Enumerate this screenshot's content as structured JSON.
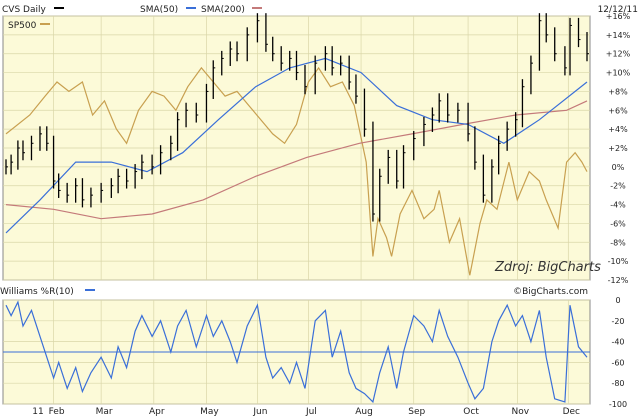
{
  "chart_data": [
    {
      "type": "ohlc",
      "title": "CVS Daily",
      "date": "12/12/11",
      "legend": [
        {
          "label": "CVS Daily",
          "color": "#000000"
        },
        {
          "label": "SMA(50)",
          "color": "#3a6fd8"
        },
        {
          "label": "SMA(200)",
          "color": "#c47a7a"
        },
        {
          "label": "SP500",
          "color": "#c8a050"
        }
      ],
      "watermark": "Zdroj: BigCharts",
      "y_axis": {
        "unit": "%",
        "min": -12,
        "max": 16,
        "ticks": [
          "+16%",
          "+14%",
          "+12%",
          "+10%",
          "+8%",
          "+6%",
          "+4%",
          "+2%",
          "0%",
          "-2%",
          "-4%",
          "-6%",
          "-8%",
          "-10%",
          "-12%"
        ],
        "position": "right"
      },
      "grid": true,
      "background": "#fcfad8",
      "colors": {
        "price": "#000000",
        "sma50": "#3a6fd8",
        "sma200": "#c47a7a",
        "sp500": "#c8a050"
      },
      "x_start": "2011-01-04",
      "x_end": "2011-12-12",
      "series": {
        "price_close": [
          {
            "x": "2011-01-04",
            "y": 0.0
          },
          {
            "x": "2011-01-07",
            "y": 0.5
          },
          {
            "x": "2011-01-11",
            "y": 2.0
          },
          {
            "x": "2011-01-14",
            "y": 1.5
          },
          {
            "x": "2011-01-19",
            "y": 2.5
          },
          {
            "x": "2011-01-24",
            "y": 3.5
          },
          {
            "x": "2011-01-28",
            "y": 2.5
          },
          {
            "x": "2011-02-01",
            "y": -1.5
          },
          {
            "x": "2011-02-04",
            "y": -2.5
          },
          {
            "x": "2011-02-09",
            "y": -3.0
          },
          {
            "x": "2011-02-14",
            "y": -2.0
          },
          {
            "x": "2011-02-18",
            "y": -3.5
          },
          {
            "x": "2011-02-23",
            "y": -3.0
          },
          {
            "x": "2011-03-01",
            "y": -2.5
          },
          {
            "x": "2011-03-07",
            "y": -2.0
          },
          {
            "x": "2011-03-11",
            "y": -1.0
          },
          {
            "x": "2011-03-16",
            "y": -1.5
          },
          {
            "x": "2011-03-21",
            "y": -0.5
          },
          {
            "x": "2011-03-25",
            "y": 0.5
          },
          {
            "x": "2011-03-31",
            "y": 0.0
          },
          {
            "x": "2011-04-05",
            "y": 1.5
          },
          {
            "x": "2011-04-11",
            "y": 2.5
          },
          {
            "x": "2011-04-15",
            "y": 5.0
          },
          {
            "x": "2011-04-20",
            "y": 6.0
          },
          {
            "x": "2011-04-26",
            "y": 5.5
          },
          {
            "x": "2011-05-02",
            "y": 8.0
          },
          {
            "x": "2011-05-06",
            "y": 10.5
          },
          {
            "x": "2011-05-11",
            "y": 11.5
          },
          {
            "x": "2011-05-16",
            "y": 12.5
          },
          {
            "x": "2011-05-20",
            "y": 12.0
          },
          {
            "x": "2011-05-26",
            "y": 14.0
          },
          {
            "x": "2011-06-01",
            "y": 15.5
          },
          {
            "x": "2011-06-06",
            "y": 13.0
          },
          {
            "x": "2011-06-10",
            "y": 12.0
          },
          {
            "x": "2011-06-15",
            "y": 11.0
          },
          {
            "x": "2011-06-20",
            "y": 11.5
          },
          {
            "x": "2011-06-24",
            "y": 10.0
          },
          {
            "x": "2011-06-29",
            "y": 8.5
          },
          {
            "x": "2011-07-05",
            "y": 11.0
          },
          {
            "x": "2011-07-11",
            "y": 12.0
          },
          {
            "x": "2011-07-15",
            "y": 10.5
          },
          {
            "x": "2011-07-20",
            "y": 11.0
          },
          {
            "x": "2011-07-25",
            "y": 9.0
          },
          {
            "x": "2011-07-29",
            "y": 7.5
          },
          {
            "x": "2011-08-03",
            "y": 4.0
          },
          {
            "x": "2011-08-08",
            "y": -5.0
          },
          {
            "x": "2011-08-12",
            "y": -1.0
          },
          {
            "x": "2011-08-17",
            "y": 1.0
          },
          {
            "x": "2011-08-22",
            "y": -1.5
          },
          {
            "x": "2011-08-26",
            "y": 1.5
          },
          {
            "x": "2011-09-01",
            "y": 3.0
          },
          {
            "x": "2011-09-07",
            "y": 4.5
          },
          {
            "x": "2011-09-12",
            "y": 5.5
          },
          {
            "x": "2011-09-16",
            "y": 7.0
          },
          {
            "x": "2011-09-21",
            "y": 5.5
          },
          {
            "x": "2011-09-27",
            "y": 6.0
          },
          {
            "x": "2011-10-03",
            "y": 3.5
          },
          {
            "x": "2011-10-07",
            "y": 0.5
          },
          {
            "x": "2011-10-12",
            "y": -3.0
          },
          {
            "x": "2011-10-17",
            "y": 0.0
          },
          {
            "x": "2011-10-21",
            "y": 2.5
          },
          {
            "x": "2011-10-26",
            "y": 4.0
          },
          {
            "x": "2011-10-31",
            "y": 5.0
          },
          {
            "x": "2011-11-04",
            "y": 8.5
          },
          {
            "x": "2011-11-09",
            "y": 11.0
          },
          {
            "x": "2011-11-14",
            "y": 15.5
          },
          {
            "x": "2011-11-18",
            "y": 14.0
          },
          {
            "x": "2011-11-23",
            "y": 12.0
          },
          {
            "x": "2011-11-29",
            "y": 10.5
          },
          {
            "x": "2011-12-02",
            "y": 15.0
          },
          {
            "x": "2011-12-07",
            "y": 13.5
          },
          {
            "x": "2011-12-12",
            "y": 12.0
          }
        ],
        "sma50": [
          {
            "x": "2011-01-04",
            "y": -7.0
          },
          {
            "x": "2011-01-24",
            "y": -3.5
          },
          {
            "x": "2011-02-14",
            "y": 0.5
          },
          {
            "x": "2011-03-07",
            "y": 0.5
          },
          {
            "x": "2011-03-28",
            "y": -0.5
          },
          {
            "x": "2011-04-18",
            "y": 1.5
          },
          {
            "x": "2011-05-09",
            "y": 5.0
          },
          {
            "x": "2011-05-31",
            "y": 8.5
          },
          {
            "x": "2011-06-20",
            "y": 10.5
          },
          {
            "x": "2011-07-11",
            "y": 11.5
          },
          {
            "x": "2011-08-01",
            "y": 10.0
          },
          {
            "x": "2011-08-22",
            "y": 6.5
          },
          {
            "x": "2011-09-12",
            "y": 5.0
          },
          {
            "x": "2011-10-03",
            "y": 4.5
          },
          {
            "x": "2011-10-24",
            "y": 2.5
          },
          {
            "x": "2011-11-14",
            "y": 5.0
          },
          {
            "x": "2011-12-12",
            "y": 9.0
          }
        ],
        "sma200": [
          {
            "x": "2011-01-04",
            "y": -4.0
          },
          {
            "x": "2011-02-01",
            "y": -4.5
          },
          {
            "x": "2011-03-01",
            "y": -5.5
          },
          {
            "x": "2011-03-31",
            "y": -5.0
          },
          {
            "x": "2011-04-30",
            "y": -3.5
          },
          {
            "x": "2011-05-31",
            "y": -1.0
          },
          {
            "x": "2011-06-30",
            "y": 1.0
          },
          {
            "x": "2011-07-31",
            "y": 2.5
          },
          {
            "x": "2011-08-31",
            "y": 3.5
          },
          {
            "x": "2011-09-30",
            "y": 4.5
          },
          {
            "x": "2011-10-31",
            "y": 5.5
          },
          {
            "x": "2011-11-30",
            "y": 6.0
          },
          {
            "x": "2011-12-12",
            "y": 7.0
          }
        ],
        "sp500": [
          {
            "x": "2011-01-04",
            "y": 3.5
          },
          {
            "x": "2011-01-18",
            "y": 5.5
          },
          {
            "x": "2011-01-27",
            "y": 7.5
          },
          {
            "x": "2011-02-03",
            "y": 9.0
          },
          {
            "x": "2011-02-10",
            "y": 8.0
          },
          {
            "x": "2011-02-18",
            "y": 9.0
          },
          {
            "x": "2011-02-24",
            "y": 5.5
          },
          {
            "x": "2011-03-03",
            "y": 7.0
          },
          {
            "x": "2011-03-10",
            "y": 4.0
          },
          {
            "x": "2011-03-16",
            "y": 2.5
          },
          {
            "x": "2011-03-23",
            "y": 6.0
          },
          {
            "x": "2011-03-31",
            "y": 8.0
          },
          {
            "x": "2011-04-07",
            "y": 7.5
          },
          {
            "x": "2011-04-14",
            "y": 6.0
          },
          {
            "x": "2011-04-21",
            "y": 8.5
          },
          {
            "x": "2011-04-29",
            "y": 10.5
          },
          {
            "x": "2011-05-06",
            "y": 9.0
          },
          {
            "x": "2011-05-13",
            "y": 7.5
          },
          {
            "x": "2011-05-20",
            "y": 8.0
          },
          {
            "x": "2011-05-27",
            "y": 6.5
          },
          {
            "x": "2011-06-03",
            "y": 5.0
          },
          {
            "x": "2011-06-10",
            "y": 3.5
          },
          {
            "x": "2011-06-17",
            "y": 2.5
          },
          {
            "x": "2011-06-24",
            "y": 4.5
          },
          {
            "x": "2011-07-01",
            "y": 9.0
          },
          {
            "x": "2011-07-07",
            "y": 10.5
          },
          {
            "x": "2011-07-14",
            "y": 8.5
          },
          {
            "x": "2011-07-21",
            "y": 9.0
          },
          {
            "x": "2011-07-28",
            "y": 6.5
          },
          {
            "x": "2011-08-04",
            "y": 0.5
          },
          {
            "x": "2011-08-08",
            "y": -9.5
          },
          {
            "x": "2011-08-11",
            "y": -5.5
          },
          {
            "x": "2011-08-16",
            "y": -7.5
          },
          {
            "x": "2011-08-19",
            "y": -9.5
          },
          {
            "x": "2011-08-24",
            "y": -5.0
          },
          {
            "x": "2011-08-31",
            "y": -2.5
          },
          {
            "x": "2011-09-07",
            "y": -5.5
          },
          {
            "x": "2011-09-13",
            "y": -4.5
          },
          {
            "x": "2011-09-16",
            "y": -2.5
          },
          {
            "x": "2011-09-22",
            "y": -8.0
          },
          {
            "x": "2011-09-28",
            "y": -5.5
          },
          {
            "x": "2011-10-04",
            "y": -11.5
          },
          {
            "x": "2011-10-10",
            "y": -6.0
          },
          {
            "x": "2011-10-14",
            "y": -3.5
          },
          {
            "x": "2011-10-20",
            "y": -4.5
          },
          {
            "x": "2011-10-27",
            "y": 0.5
          },
          {
            "x": "2011-11-01",
            "y": -3.5
          },
          {
            "x": "2011-11-08",
            "y": -0.5
          },
          {
            "x": "2011-11-14",
            "y": -1.5
          },
          {
            "x": "2011-11-18",
            "y": -3.5
          },
          {
            "x": "2011-11-25",
            "y": -6.5
          },
          {
            "x": "2011-11-30",
            "y": 0.5
          },
          {
            "x": "2011-12-05",
            "y": 1.5
          },
          {
            "x": "2011-12-09",
            "y": 0.5
          },
          {
            "x": "2011-12-12",
            "y": -0.5
          }
        ]
      }
    },
    {
      "type": "line",
      "title": "Williams %R(10)",
      "series": [
        {
          "name": "Williams %R(10)",
          "color": "#3a6fd8"
        }
      ],
      "y_axis": {
        "min": -100,
        "max": 0,
        "ticks": [
          "0",
          "-20",
          "-40",
          "-60",
          "-80",
          "-100"
        ],
        "position": "right"
      },
      "reference_line": -50,
      "grid": true,
      "background": "#fcfad8",
      "x_ticks": [
        "11",
        "Feb",
        "Mar",
        "Apr",
        "May",
        "Jun",
        "Jul",
        "Aug",
        "Sep",
        "Oct",
        "Nov",
        "Dec"
      ],
      "values": [
        {
          "x": "2011-01-04",
          "y": -5
        },
        {
          "x": "2011-01-07",
          "y": -15
        },
        {
          "x": "2011-01-11",
          "y": -2
        },
        {
          "x": "2011-01-14",
          "y": -25
        },
        {
          "x": "2011-01-19",
          "y": -10
        },
        {
          "x": "2011-01-24",
          "y": -35
        },
        {
          "x": "2011-01-28",
          "y": -55
        },
        {
          "x": "2011-02-01",
          "y": -75
        },
        {
          "x": "2011-02-04",
          "y": -60
        },
        {
          "x": "2011-02-09",
          "y": -85
        },
        {
          "x": "2011-02-14",
          "y": -65
        },
        {
          "x": "2011-02-18",
          "y": -88
        },
        {
          "x": "2011-02-23",
          "y": -70
        },
        {
          "x": "2011-03-01",
          "y": -55
        },
        {
          "x": "2011-03-07",
          "y": -75
        },
        {
          "x": "2011-03-11",
          "y": -45
        },
        {
          "x": "2011-03-16",
          "y": -65
        },
        {
          "x": "2011-03-21",
          "y": -30
        },
        {
          "x": "2011-03-25",
          "y": -15
        },
        {
          "x": "2011-03-31",
          "y": -35
        },
        {
          "x": "2011-04-05",
          "y": -20
        },
        {
          "x": "2011-04-11",
          "y": -50
        },
        {
          "x": "2011-04-15",
          "y": -25
        },
        {
          "x": "2011-04-20",
          "y": -10
        },
        {
          "x": "2011-04-26",
          "y": -45
        },
        {
          "x": "2011-05-02",
          "y": -15
        },
        {
          "x": "2011-05-06",
          "y": -35
        },
        {
          "x": "2011-05-11",
          "y": -20
        },
        {
          "x": "2011-05-16",
          "y": -40
        },
        {
          "x": "2011-05-20",
          "y": -60
        },
        {
          "x": "2011-05-26",
          "y": -25
        },
        {
          "x": "2011-06-01",
          "y": -5
        },
        {
          "x": "2011-06-06",
          "y": -55
        },
        {
          "x": "2011-06-10",
          "y": -75
        },
        {
          "x": "2011-06-15",
          "y": -65
        },
        {
          "x": "2011-06-20",
          "y": -80
        },
        {
          "x": "2011-06-24",
          "y": -60
        },
        {
          "x": "2011-06-29",
          "y": -85
        },
        {
          "x": "2011-07-05",
          "y": -20
        },
        {
          "x": "2011-07-11",
          "y": -10
        },
        {
          "x": "2011-07-15",
          "y": -55
        },
        {
          "x": "2011-07-20",
          "y": -30
        },
        {
          "x": "2011-07-25",
          "y": -70
        },
        {
          "x": "2011-07-29",
          "y": -85
        },
        {
          "x": "2011-08-03",
          "y": -90
        },
        {
          "x": "2011-08-08",
          "y": -98
        },
        {
          "x": "2011-08-12",
          "y": -70
        },
        {
          "x": "2011-08-17",
          "y": -45
        },
        {
          "x": "2011-08-22",
          "y": -85
        },
        {
          "x": "2011-08-26",
          "y": -50
        },
        {
          "x": "2011-09-01",
          "y": -15
        },
        {
          "x": "2011-09-07",
          "y": -25
        },
        {
          "x": "2011-09-12",
          "y": -40
        },
        {
          "x": "2011-09-16",
          "y": -10
        },
        {
          "x": "2011-09-21",
          "y": -35
        },
        {
          "x": "2011-09-27",
          "y": -55
        },
        {
          "x": "2011-10-03",
          "y": -80
        },
        {
          "x": "2011-10-07",
          "y": -95
        },
        {
          "x": "2011-10-12",
          "y": -85
        },
        {
          "x": "2011-10-17",
          "y": -40
        },
        {
          "x": "2011-10-21",
          "y": -20
        },
        {
          "x": "2011-10-26",
          "y": -5
        },
        {
          "x": "2011-10-31",
          "y": -25
        },
        {
          "x": "2011-11-04",
          "y": -15
        },
        {
          "x": "2011-11-09",
          "y": -40
        },
        {
          "x": "2011-11-14",
          "y": -10
        },
        {
          "x": "2011-11-18",
          "y": -55
        },
        {
          "x": "2011-11-23",
          "y": -95
        },
        {
          "x": "2011-11-29",
          "y": -98
        },
        {
          "x": "2011-12-02",
          "y": -5
        },
        {
          "x": "2011-12-07",
          "y": -45
        },
        {
          "x": "2011-12-12",
          "y": -55
        }
      ],
      "footer_credit": "©BigCharts.com"
    }
  ]
}
